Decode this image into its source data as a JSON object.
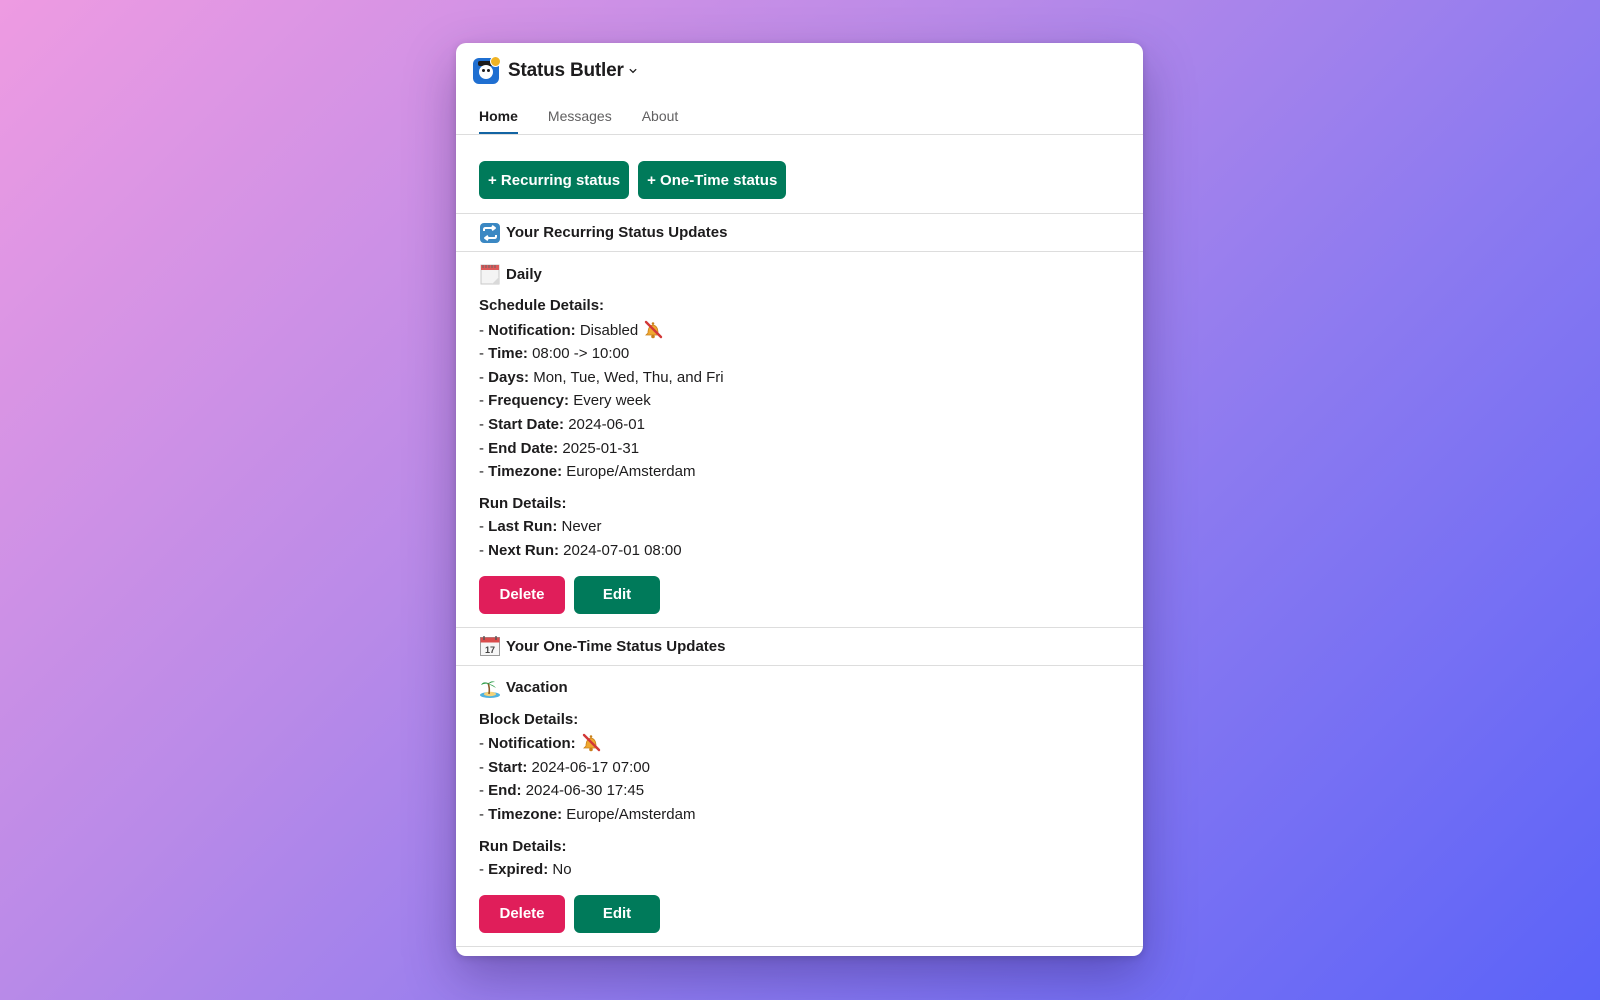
{
  "app": {
    "title": "Status Butler"
  },
  "tabs": [
    "Home",
    "Messages",
    "About"
  ],
  "actions": {
    "recurring": "+ Recurring status",
    "onetime": "+ One-Time status"
  },
  "recurring": {
    "section_title": "Your Recurring Status Updates",
    "item_title": "Daily",
    "schedule_heading": "Schedule Details:",
    "rows": [
      {
        "prefix": "- ",
        "label": "Notification:",
        "value": " Disabled"
      },
      {
        "prefix": "- ",
        "label": "Time:",
        "value": " 08:00 -> 10:00"
      },
      {
        "prefix": "- ",
        "label": "Days:",
        "value": " Mon, Tue, Wed, Thu, and Fri"
      },
      {
        "prefix": "- ",
        "label": "Frequency:",
        "value": " Every week"
      },
      {
        "prefix": "- ",
        "label": "Start Date:",
        "value": " 2024-06-01"
      },
      {
        "prefix": "- ",
        "label": "End Date:",
        "value": " 2025-01-31"
      },
      {
        "prefix": "- ",
        "label": "Timezone:",
        "value": " Europe/Amsterdam"
      }
    ],
    "run_heading": "Run Details:",
    "run_rows": [
      {
        "prefix": "- ",
        "label": "Last Run:",
        "value": " Never"
      },
      {
        "prefix": "- ",
        "label": "Next Run:",
        "value": " 2024-07-01 08:00"
      }
    ],
    "delete": "Delete",
    "edit": "Edit"
  },
  "onetime": {
    "section_title": "Your One-Time Status Updates",
    "item_title": "Vacation",
    "block_heading": "Block Details:",
    "rows": [
      {
        "prefix": "- ",
        "label": "Notification:",
        "value": ""
      },
      {
        "prefix": "- ",
        "label": "Start:",
        "value": " 2024-06-17 07:00"
      },
      {
        "prefix": "- ",
        "label": "End:",
        "value": " 2024-06-30 17:45"
      },
      {
        "prefix": "- ",
        "label": "Timezone:",
        "value": " Europe/Amsterdam"
      }
    ],
    "run_heading": "Run Details:",
    "run_rows": [
      {
        "prefix": "- ",
        "label": "Expired:",
        "value": " No"
      }
    ],
    "delete": "Delete",
    "edit": "Edit"
  },
  "icons": {
    "app": "butler-app-icon",
    "recurring": "repeat-icon",
    "daily": "notepad-calendar-icon",
    "onetime": "calendar-icon",
    "vacation": "desert-island-icon",
    "bell": "bell-slash-icon"
  },
  "colors": {
    "accent_green": "#007a5a",
    "danger_red": "#e01e5a",
    "tab_underline": "#1264a3"
  }
}
